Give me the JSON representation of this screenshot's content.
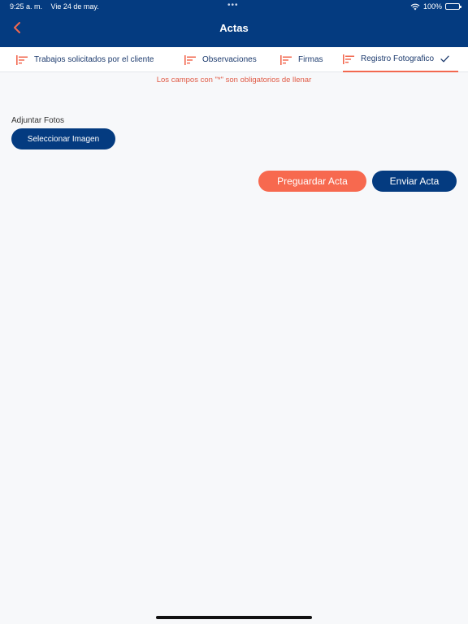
{
  "status_bar": {
    "time": "9:25 a. m.",
    "date": "Vie 24 de may.",
    "dots": "•••",
    "battery": "100%"
  },
  "header": {
    "title": "Actas",
    "back_icon": "chevron-left-icon"
  },
  "tabs": [
    {
      "label": "Trabajos solicitados por el cliente",
      "icon": "align-left-icon"
    },
    {
      "label": "Observaciones",
      "icon": "align-left-icon"
    },
    {
      "label": "Firmas",
      "icon": "align-left-icon"
    },
    {
      "label": "Registro Fotografico",
      "icon": "align-left-icon",
      "active": true,
      "status_icon": "check-icon"
    }
  ],
  "form": {
    "required_note": "Los campos con \"*\" son obligatorios de llenar",
    "attach_label": "Adjuntar Fotos",
    "select_image_label": "Seleccionar Imagen"
  },
  "actions": {
    "presave_label": "Preguardar Acta",
    "send_label": "Enviar Acta"
  },
  "colors": {
    "primary": "#043b80",
    "accent": "#f7694f",
    "background": "#f7f8fa"
  }
}
